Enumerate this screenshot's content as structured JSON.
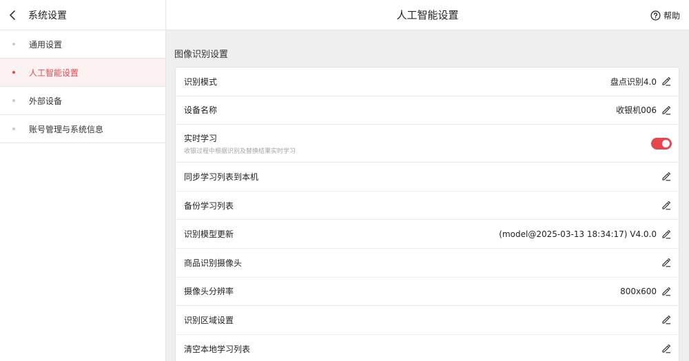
{
  "sidebar": {
    "title": "系统设置",
    "items": [
      {
        "label": "通用设置",
        "active": false
      },
      {
        "label": "人工智能设置",
        "active": true
      },
      {
        "label": "外部设备",
        "active": false
      },
      {
        "label": "账号管理与系统信息",
        "active": false
      }
    ]
  },
  "header": {
    "title": "人工智能设置",
    "help_label": "帮助"
  },
  "section": {
    "title": "图像识别设置"
  },
  "settings": [
    {
      "label": "识别模式",
      "value": "盘点识别4.0",
      "control": "edit"
    },
    {
      "label": "设备名称",
      "value": "收银机006",
      "control": "edit"
    },
    {
      "label": "实时学习",
      "sublabel": "收银过程中根据识别及替换结果实时学习",
      "control": "toggle",
      "enabled": true
    },
    {
      "label": "同步学习列表到本机",
      "value": "",
      "control": "edit"
    },
    {
      "label": "备份学习列表",
      "value": "",
      "control": "edit"
    },
    {
      "label": "识别模型更新",
      "value": "(model@2025-03-13 18:34:17) V4.0.0",
      "control": "edit"
    },
    {
      "label": "商品识别摄像头",
      "value": "",
      "control": "edit"
    },
    {
      "label": "摄像头分辨率",
      "value": "800x600",
      "control": "edit"
    },
    {
      "label": "识别区域设置",
      "value": "",
      "control": "edit"
    },
    {
      "label": "清空本地学习列表",
      "value": "",
      "control": "edit"
    }
  ],
  "colors": {
    "accent": "#e8464e",
    "active_bg": "#fdf2f2",
    "background": "#efefef"
  },
  "icons": {
    "back": "chevron-left-icon",
    "help": "question-circle-icon",
    "edit": "pencil-icon"
  }
}
